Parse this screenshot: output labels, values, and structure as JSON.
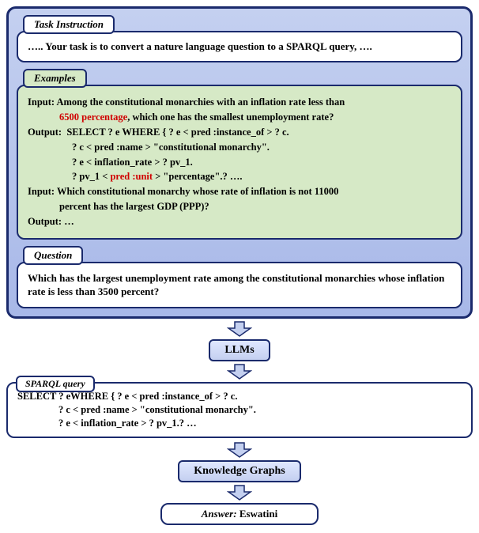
{
  "labels": {
    "task": "Task Instruction",
    "examples": "Examples",
    "question": "Question",
    "llms": "LLMs",
    "sparql": "SPARQL query",
    "kg": "Knowledge Graphs",
    "answer_label": "Answer:",
    "answer_value": "Eswatini"
  },
  "task_text": "….. Your task is to convert a nature language question to a SPARQL query, ….",
  "examples": {
    "in1_a": "Input: Among the constitutional monarchies with an inflation rate less than",
    "in1_b_red": "6500 percentage",
    "in1_b_tail": ", which one has the smallest unemployment rate?",
    "out_label": "Output:",
    "out_l1": "SELECT ? e WHERE { ? e < pred :instance_of > ? c.",
    "out_l2": "? c < pred :name > \"constitutional monarchy\".",
    "out_l3": "? e < inflation_rate > ? pv_1.",
    "out_l4_a": "? pv_1 < ",
    "out_l4_red": "pred :unit",
    "out_l4_b": " > \"percentage\".? ….",
    "in2_a": "Input: Which constitutional monarchy whose rate of inflation is not 11000",
    "in2_b": "percent has the largest GDP (PPP)?",
    "out2": "Output: …"
  },
  "question_text": "Which has the largest unemployment rate among the constitutional monarchies whose inflation rate is less than 3500 percent?",
  "sparql": {
    "l1": "SELECT ? eWHERE { ? e < pred :instance_of > ? c.",
    "l2": "? c < pred :name > \"constitutional monarchy\".",
    "l3": "? e < inflation_rate > ? pv_1.? …"
  }
}
